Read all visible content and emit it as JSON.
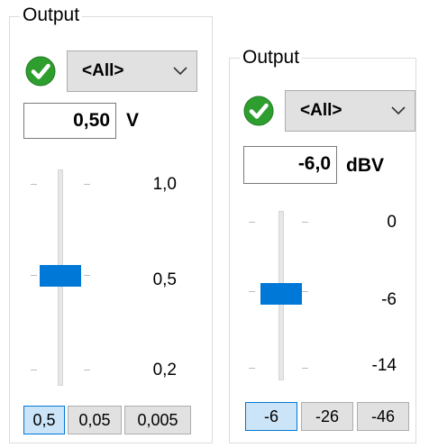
{
  "panel_left": {
    "legend": "Output",
    "status_icon": "green-check-icon",
    "channel_select": {
      "selected": "<All>",
      "icon": "chevron-down-icon"
    },
    "value": "0,50",
    "unit": "V",
    "scale_labels": [
      "1,0",
      "0,5",
      "0,2"
    ],
    "slider_value": "0,5",
    "step_buttons": [
      {
        "label": "0,5",
        "active": true
      },
      {
        "label": "0,05",
        "active": false
      },
      {
        "label": "0,005",
        "active": false
      }
    ]
  },
  "panel_right": {
    "legend": "Output",
    "status_icon": "green-check-icon",
    "channel_select": {
      "selected": "<All>",
      "icon": "chevron-down-icon"
    },
    "value": "-6,0",
    "unit": "dBV",
    "scale_labels": [
      "0",
      "-6",
      "-14"
    ],
    "slider_value": "-6",
    "step_buttons": [
      {
        "label": "-6",
        "active": true
      },
      {
        "label": "-26",
        "active": false
      },
      {
        "label": "-46",
        "active": false
      }
    ]
  },
  "colors": {
    "accent": "#0078d7",
    "check_green": "#2e9e2e",
    "button_bg": "#e1e1e1",
    "active_button_bg": "#cce4f7"
  }
}
